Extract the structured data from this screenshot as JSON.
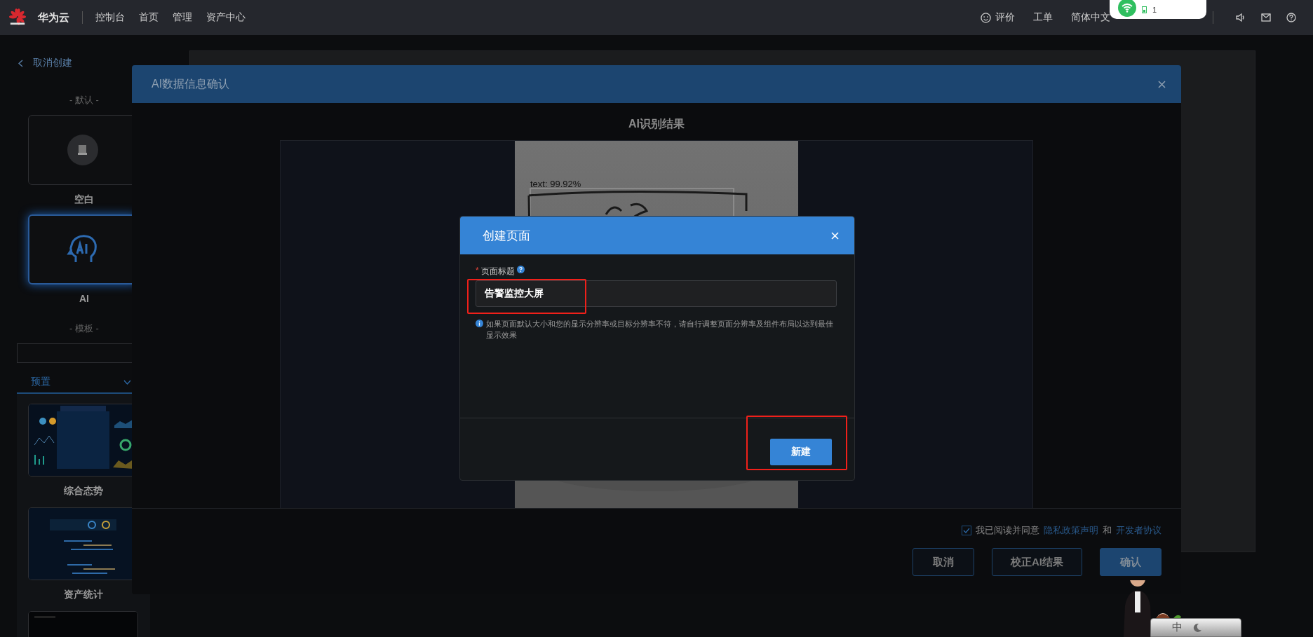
{
  "top_bar": {
    "brand": "华为云",
    "nav": [
      "控制台",
      "首页",
      "管理",
      "资产中心"
    ],
    "feedback": "评价",
    "ticket": "工单",
    "language": "简体中文"
  },
  "status_widget": {
    "count": "1"
  },
  "back_link": "取消创建",
  "sidebar": {
    "default_heading": "- 默认 -",
    "default_items": [
      {
        "label": "空白",
        "kind": "blank",
        "selected": false
      },
      {
        "label": "AI",
        "kind": "ai",
        "selected": true
      }
    ],
    "template_heading": "- 模板 -",
    "tab": {
      "label": "预置",
      "expanded": true
    },
    "templates": [
      {
        "label": "综合态势",
        "kind": "overview"
      },
      {
        "label": "资产统计",
        "kind": "bars"
      },
      {
        "kind": "dark"
      }
    ]
  },
  "ai_dialog": {
    "title": "AI数据信息确认",
    "section_title": "AI识别结果",
    "detection_label": "text: 99.92%",
    "agreement": {
      "checked": true,
      "prefix": "我已阅读并同意",
      "link_1": "隐私政策声明",
      "joiner": "和",
      "link_2": "开发者协议"
    },
    "buttons": [
      {
        "label": "取消",
        "kind": "secondary"
      },
      {
        "label": "校正AI结果",
        "kind": "secondary"
      },
      {
        "label": "确认",
        "kind": "primary"
      }
    ]
  },
  "create_dialog": {
    "title": "创建页面",
    "field_label": "页面标题",
    "required_mark": "*",
    "value": "告警监控大屏",
    "value_highlighted": true,
    "hint": "如果页面默认大小和您的显示分辨率或目标分辨率不符，请自行调整页面分辨率及组件布局以达到最佳显示效果",
    "submit": "新建",
    "submit_highlighted": true
  },
  "ime_toolbar": {
    "label": "中"
  }
}
